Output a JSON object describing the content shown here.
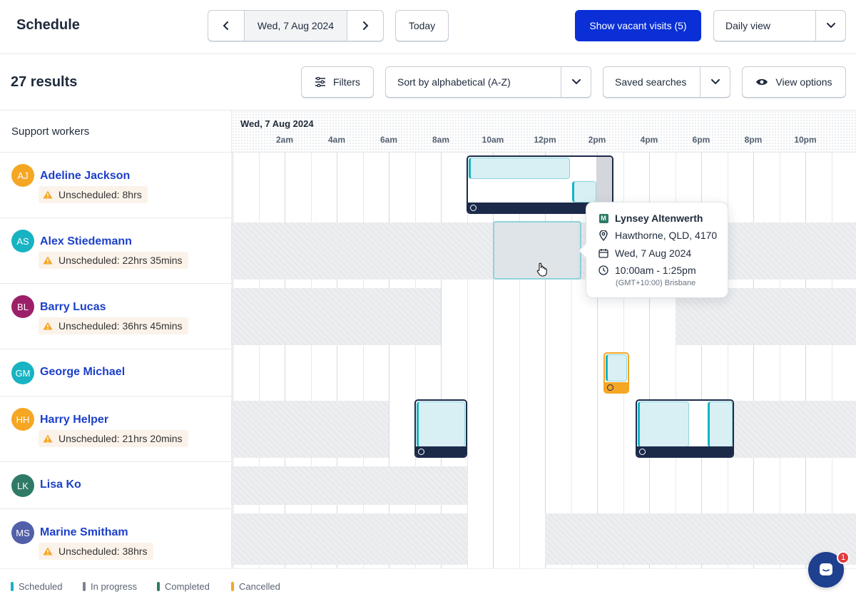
{
  "header": {
    "title": "Schedule",
    "current_date": "Wed, 7 Aug 2024",
    "today_label": "Today",
    "vacant_label": "Show vacant visits (5)",
    "view_select": "Daily view"
  },
  "toolbar": {
    "results": "27 results",
    "filters_label": "Filters",
    "sort_select": "Sort by alphabetical (A-Z)",
    "saved_select": "Saved searches",
    "view_options_label": "View options"
  },
  "timeline": {
    "column_header": "Support workers",
    "date": "Wed, 7 Aug 2024",
    "ticks": [
      "2am",
      "4am",
      "6am",
      "8am",
      "10am",
      "12pm",
      "2pm",
      "4pm",
      "6pm",
      "8pm",
      "10pm"
    ]
  },
  "workers": [
    {
      "initials": "AJ",
      "name": "Adeline Jackson",
      "badge": "Unscheduled: 8hrs",
      "color": "#f5a623"
    },
    {
      "initials": "AS",
      "name": "Alex Stiedemann",
      "badge": "Unscheduled: 22hrs 35mins",
      "color": "#17b3c2"
    },
    {
      "initials": "BL",
      "name": "Barry Lucas",
      "badge": "Unscheduled: 36hrs 45mins",
      "color": "#9c1f6a"
    },
    {
      "initials": "GM",
      "name": "George Michael",
      "badge": "",
      "color": "#17b3c2"
    },
    {
      "initials": "HH",
      "name": "Harry Helper",
      "badge": "Unscheduled: 21hrs 20mins",
      "color": "#f5a623"
    },
    {
      "initials": "LK",
      "name": "Lisa Ko",
      "badge": "",
      "color": "#2f7a66"
    },
    {
      "initials": "MS",
      "name": "Marine Smitham",
      "badge": "Unscheduled: 38hrs",
      "color": "#5160a8"
    }
  ],
  "tooltip": {
    "client": "Lynsey Altenwerth",
    "address": "Hawthorne, QLD, 4170",
    "date": "Wed, 7 Aug 2024",
    "time": "10:00am - 1:25pm",
    "timezone": "(GMT+10:00) Brisbane"
  },
  "legend": [
    {
      "label": "Scheduled",
      "color": "#17b3c2"
    },
    {
      "label": "In progress",
      "color": "#7a8494"
    },
    {
      "label": "Completed",
      "color": "#2f7a66"
    },
    {
      "label": "Cancelled",
      "color": "#f5a623"
    }
  ],
  "chat": {
    "badge": "1"
  }
}
